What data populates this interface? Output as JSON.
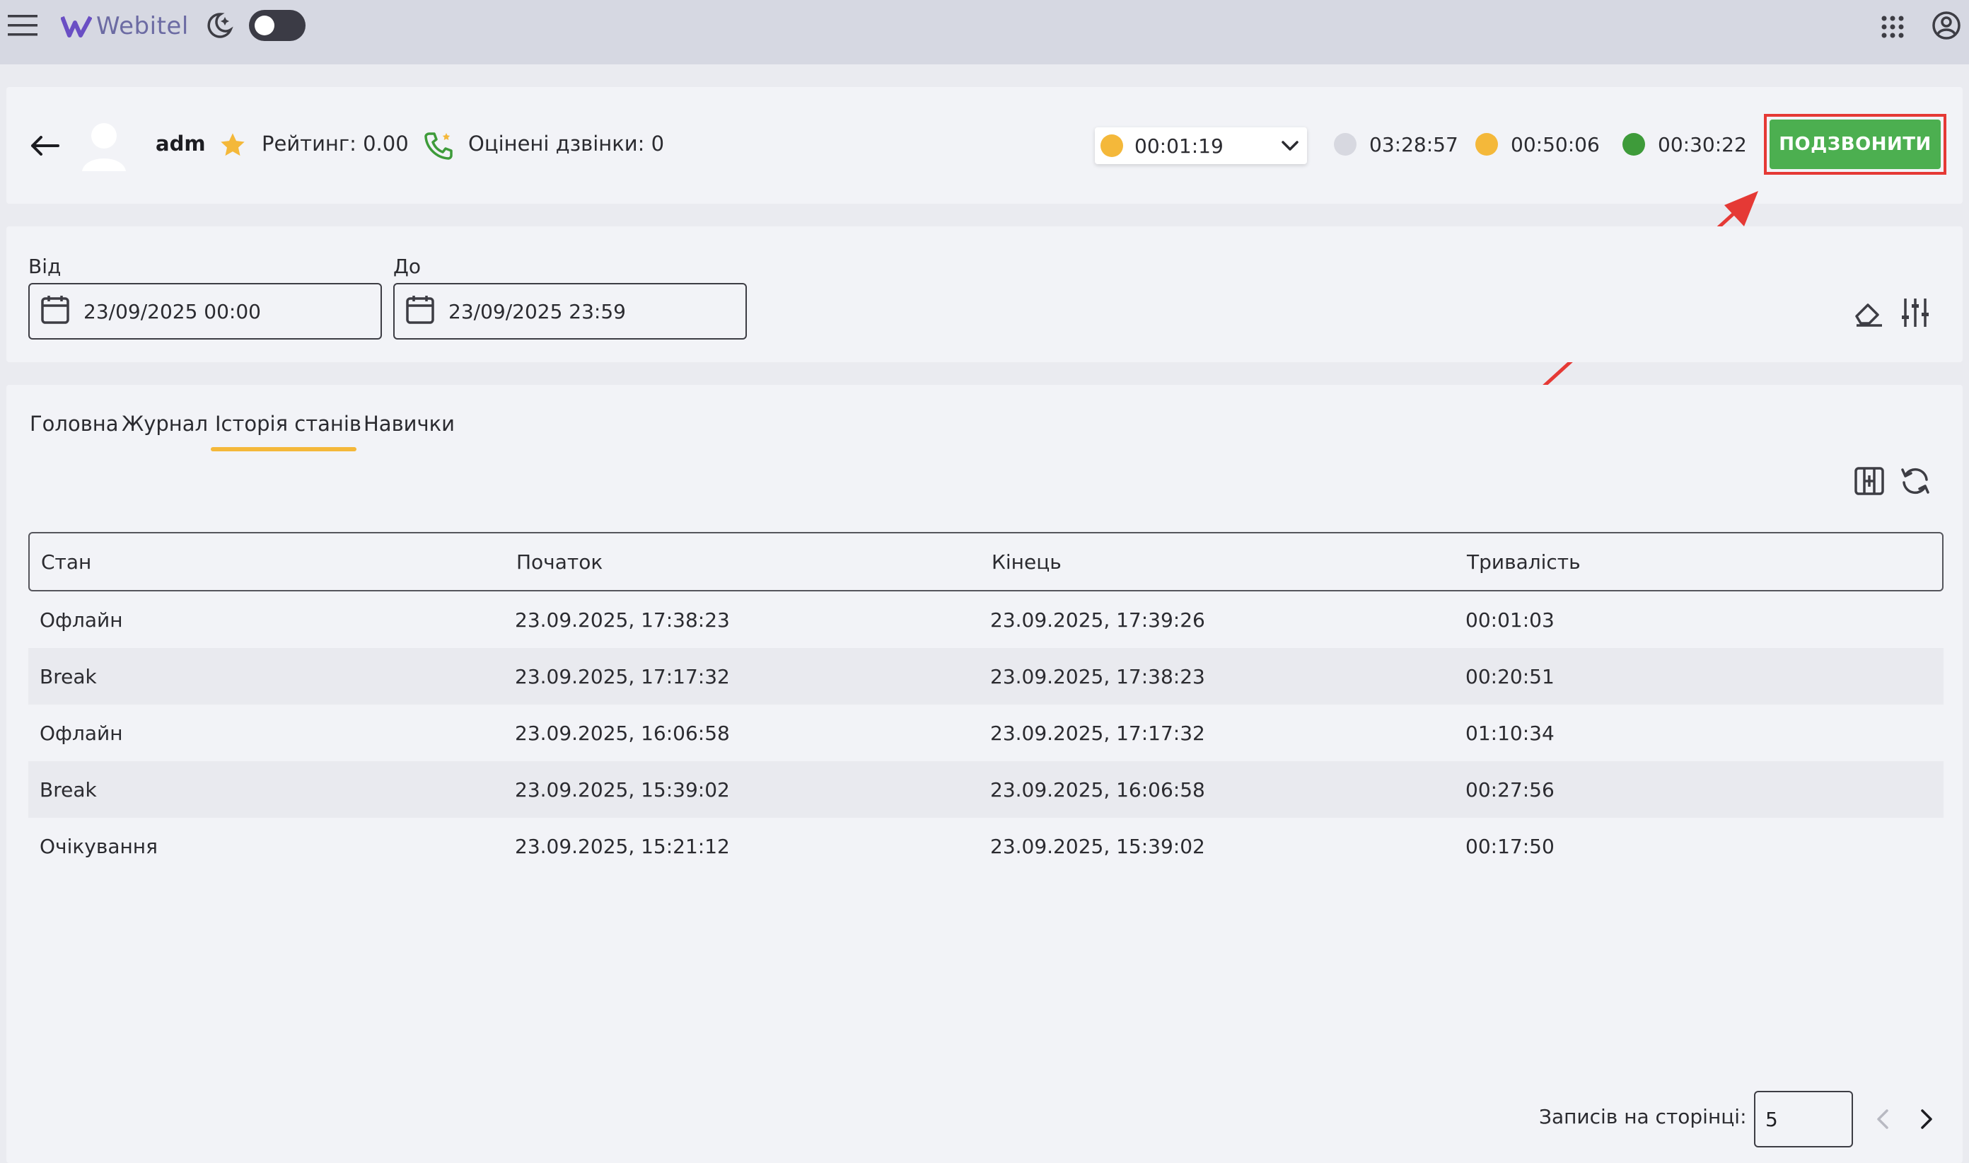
{
  "topbar": {
    "menu_icon": "hamburger-icon",
    "logo_text": "Webitel",
    "theme_icon": "moon-stars-icon",
    "apps_icon": "grid-dots-icon",
    "account_icon": "user-circle-icon"
  },
  "agent": {
    "name": "adm",
    "rating": "Рейтинг: 0.00",
    "rated_calls": "Оцінені дзвінки: 0",
    "current_status_time": "00:01:19",
    "stats": [
      {
        "time": "03:28:57",
        "color": "#d7d8e0"
      },
      {
        "time": "00:50:06",
        "color": "#f4b83a"
      },
      {
        "time": "00:30:22",
        "color": "#3e9b3a"
      }
    ],
    "call_button": "ПОДЗВОНИТИ"
  },
  "filters": {
    "from_label": "Від",
    "from_value": "23/09/2025 00:00",
    "to_label": "До",
    "to_value": "23/09/2025 23:59"
  },
  "tabs": [
    {
      "label": "Головна"
    },
    {
      "label": "Журнал"
    },
    {
      "label": "Історія станів",
      "active": true
    },
    {
      "label": "Навички"
    }
  ],
  "table": {
    "headers": [
      "Стан",
      "Початок",
      "Кінець",
      "Тривалість"
    ],
    "rows": [
      [
        "Офлайн",
        "23.09.2025, 17:38:23",
        "23.09.2025, 17:39:26",
        "00:01:03"
      ],
      [
        "Break",
        "23.09.2025, 17:17:32",
        "23.09.2025, 17:38:23",
        "00:20:51"
      ],
      [
        "Офлайн",
        "23.09.2025, 16:06:58",
        "23.09.2025, 17:17:32",
        "01:10:34"
      ],
      [
        "Break",
        "23.09.2025, 15:39:02",
        "23.09.2025, 16:06:58",
        "00:27:56"
      ],
      [
        "Очікування",
        "23.09.2025, 15:21:12",
        "23.09.2025, 15:39:02",
        "00:17:50"
      ]
    ]
  },
  "pagination": {
    "label": "Записів на сторінці:",
    "per_page": "5"
  },
  "colors": {
    "accent": "#4caf50",
    "highlight": "#e53935",
    "tab_underline": "#f4b83a"
  }
}
